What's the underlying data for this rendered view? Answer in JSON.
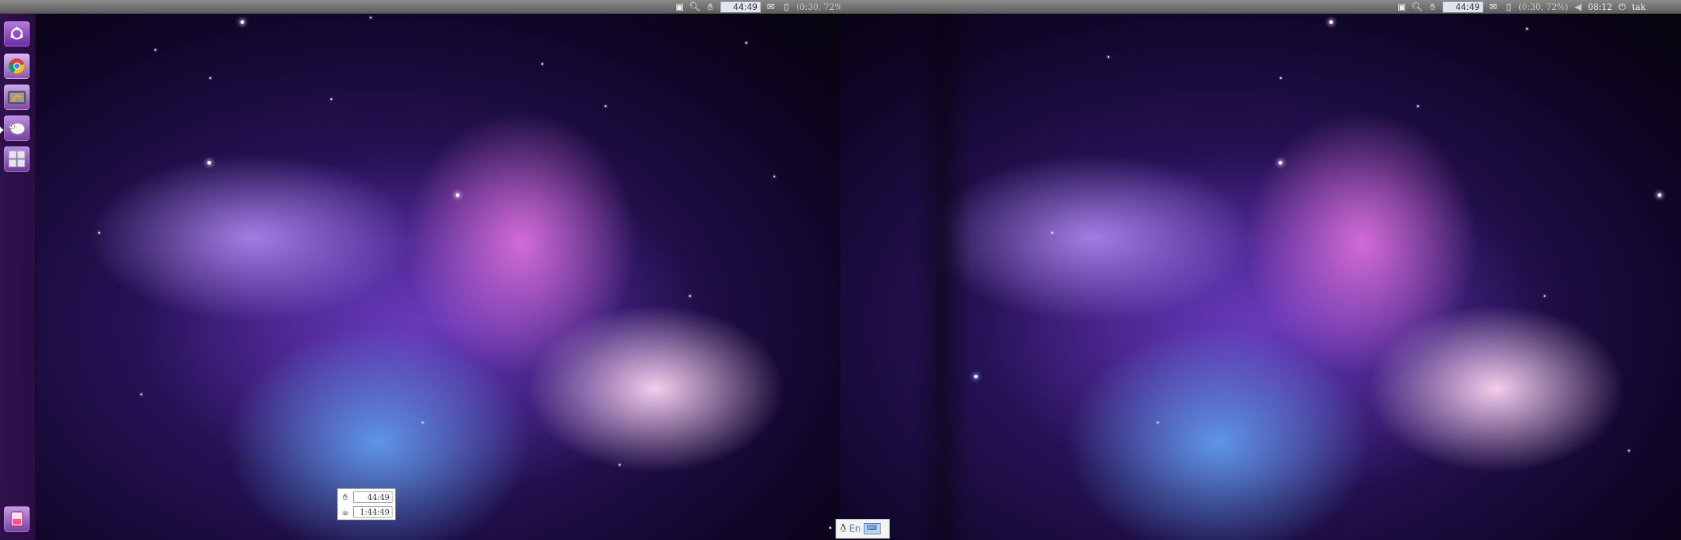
{
  "top_panel": {
    "indicators": {
      "timer_value": "44:49",
      "battery_text": "(0:30, 72%)",
      "clock": "08:12",
      "user_name": "tak"
    }
  },
  "launcher": {
    "items": [
      {
        "name": "Dash home",
        "icon": "ubuntu-logo-icon"
      },
      {
        "name": "Chromium",
        "icon": "chrome-icon"
      },
      {
        "name": "Files",
        "icon": "files-icon"
      },
      {
        "name": "Pidgin",
        "icon": "pidgin-icon"
      },
      {
        "name": "Workspaces",
        "icon": "workspace-switcher-icon"
      },
      {
        "name": "Trash",
        "icon": "trash-icon"
      }
    ]
  },
  "timer_widget": {
    "row1_value": "44:49",
    "row2_value": "1:44:49"
  },
  "input_method": {
    "language": "En",
    "keyboard_label": "⌨"
  },
  "colors": {
    "panel_top": "#8a8a8a",
    "panel_bottom": "#5c5c5c",
    "launcher_bg": "#32124f",
    "wallpaper_core": "#3a1878",
    "wallpaper_pink": "#ec78e6",
    "wallpaper_blue": "#64aafa"
  }
}
